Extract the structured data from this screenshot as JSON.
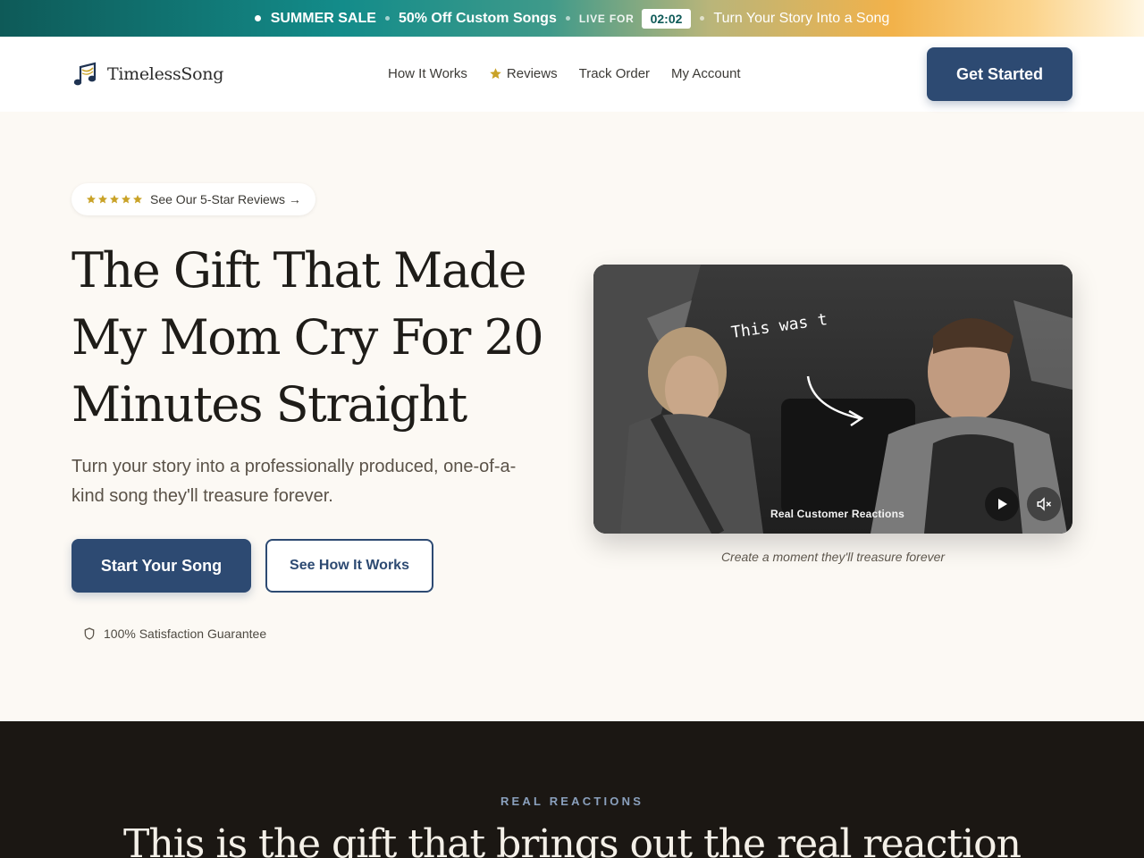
{
  "promo": {
    "sale_label": "SUMMER SALE",
    "offer": "50% Off Custom Songs",
    "live_label": "LIVE FOR",
    "timer": "02:02",
    "tagline": "Turn Your Story Into a Song"
  },
  "nav": {
    "brand": "TimelessSong",
    "links": [
      {
        "label": "How It Works"
      },
      {
        "label": "Reviews",
        "icon": "star-icon"
      },
      {
        "label": "Track Order"
      },
      {
        "label": "My Account"
      }
    ],
    "cta": "Get Started"
  },
  "hero": {
    "reviews_pill": "See Our 5-Star Reviews →",
    "title_line1": "The Gift That Made",
    "title_line2": "My Mom Cry For 20",
    "title_line3": "Minutes Straight",
    "subtitle": "Turn your story into a professionally produced, one-of-a-kind song they'll treasure forever.",
    "primary_button": "Start Your Song",
    "secondary_button": "See How It Works",
    "guarantee": "100% Satisfaction Guarantee"
  },
  "video": {
    "handwritten_overlay": "This was t",
    "overlay_caption": "Real Customer Reactions",
    "play_icon": "play-icon",
    "mute_icon": "volume-muted-icon",
    "caption": "Create a moment they'll treasure forever"
  },
  "reactions": {
    "kicker": "REAL REACTIONS",
    "title": "This is the gift that brings out the real reaction"
  },
  "colors": {
    "brand_navy": "#2d4a72",
    "promo_start": "#0e5a58",
    "promo_end": "#fbd38a",
    "star_gold": "#c9a227",
    "dark_section": "#1b1713"
  }
}
